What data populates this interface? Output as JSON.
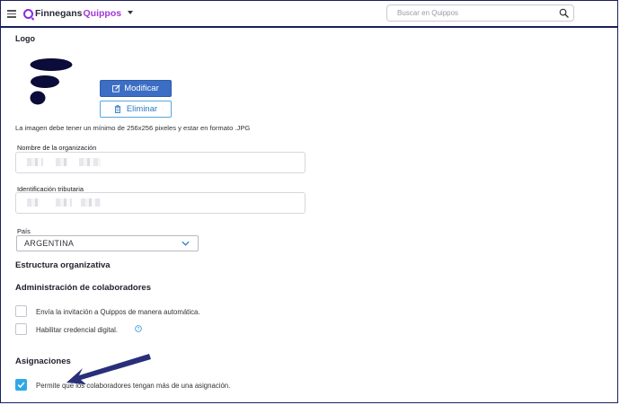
{
  "header": {
    "brand_primary": "Finnegans",
    "brand_secondary": "Quippos",
    "search_placeholder": "Buscar en Quippos"
  },
  "logo_section": {
    "title": "Logo",
    "modify_label": "Modificar",
    "delete_label": "Eliminar",
    "note": "La imagen debe tener un mínimo de 256x256 pixeles y estar en formato .JPG"
  },
  "fields": {
    "org_name_label": "Nombre de la organización",
    "org_name_value": "",
    "tax_id_label": "Identificación tributaria",
    "tax_id_value": "",
    "country_label": "País",
    "country_value": "ARGENTINA"
  },
  "sections": {
    "structure_title": "Estructura organizativa",
    "collaborators_title": "Administración de colaboradores",
    "assignments_title": "Asignaciones"
  },
  "collaborators": {
    "auto_invite_label": "Envía la invitación a Quippos de manera automática.",
    "auto_invite_checked": false,
    "digital_credential_label": "Habilitar credencial digital.",
    "digital_credential_checked": false
  },
  "assignments": {
    "multi_assignment_label": "Permite que los colaboradores tengan más de una asignación.",
    "multi_assignment_checked": true
  },
  "colors": {
    "brand_purple": "#a235d6",
    "primary_button": "#3b6ec4",
    "outline_button": "#5aa6df",
    "checkbox_checked": "#2fa9e6",
    "frame": "#1b1f5e",
    "annotation_arrow": "#2a2f7a"
  }
}
